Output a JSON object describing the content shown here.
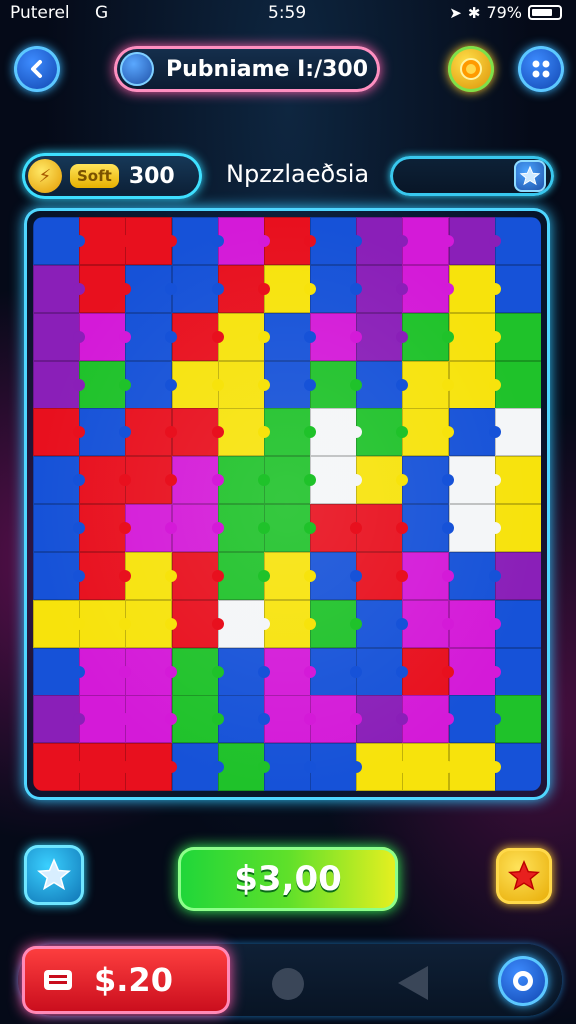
{
  "status_bar": {
    "carrier": "Puterel",
    "network": "G",
    "time": "5:59",
    "battery": "79%"
  },
  "header": {
    "title": "Pubniame I:/300"
  },
  "info_row": {
    "soft_label": "Soft",
    "score": "300",
    "puzzle_name": "Npzzlaeðsia"
  },
  "actions": {
    "price_main": "$3,00",
    "price_red": "$.20"
  },
  "colors": {
    "red": "#e8101e",
    "yellow": "#f7e30c",
    "blue": "#1652d8",
    "purple": "#8a1fb8",
    "magenta": "#d41ad8",
    "green": "#1fc22a",
    "white": "#f4f6f8",
    "cyan_glow": "#33c8ff",
    "pink_glow": "#ff6fb0"
  },
  "board": {
    "cols": 11,
    "rows": 12,
    "grid": [
      [
        "blue",
        "red",
        "red",
        "blue",
        "magenta",
        "red",
        "blue",
        "purple",
        "magenta",
        "purple",
        "blue"
      ],
      [
        "purple",
        "red",
        "blue",
        "blue",
        "red",
        "yellow",
        "blue",
        "purple",
        "magenta",
        "yellow",
        "blue"
      ],
      [
        "purple",
        "magenta",
        "blue",
        "red",
        "yellow",
        "blue",
        "magenta",
        "purple",
        "green",
        "yellow",
        "green"
      ],
      [
        "purple",
        "green",
        "blue",
        "yellow",
        "yellow",
        "blue",
        "green",
        "blue",
        "yellow",
        "yellow",
        "green"
      ],
      [
        "red",
        "blue",
        "red",
        "red",
        "yellow",
        "green",
        "white",
        "green",
        "yellow",
        "blue",
        "white"
      ],
      [
        "blue",
        "red",
        "red",
        "magenta",
        "green",
        "green",
        "white",
        "yellow",
        "blue",
        "white",
        "yellow"
      ],
      [
        "blue",
        "red",
        "magenta",
        "magenta",
        "green",
        "green",
        "red",
        "red",
        "blue",
        "white",
        "yellow"
      ],
      [
        "blue",
        "red",
        "yellow",
        "red",
        "green",
        "yellow",
        "blue",
        "red",
        "magenta",
        "blue",
        "purple"
      ],
      [
        "yellow",
        "yellow",
        "yellow",
        "red",
        "white",
        "yellow",
        "green",
        "blue",
        "magenta",
        "magenta",
        "blue"
      ],
      [
        "blue",
        "magenta",
        "magenta",
        "green",
        "blue",
        "magenta",
        "blue",
        "blue",
        "red",
        "magenta",
        "blue"
      ],
      [
        "purple",
        "magenta",
        "magenta",
        "green",
        "blue",
        "magenta",
        "magenta",
        "purple",
        "magenta",
        "blue",
        "green"
      ],
      [
        "red",
        "red",
        "red",
        "blue",
        "green",
        "blue",
        "blue",
        "yellow",
        "yellow",
        "yellow",
        "blue"
      ]
    ]
  },
  "icons": {
    "back": "chevron-left-icon",
    "menu": "grid-dots-icon",
    "coin": "coin-icon",
    "globe": "globe-icon",
    "lightning": "lightning-icon",
    "star": "star-icon",
    "red_star": "red-star-icon",
    "card": "card-icon",
    "home": "circle-icon",
    "nav_back": "triangle-back-icon",
    "target": "target-icon"
  }
}
